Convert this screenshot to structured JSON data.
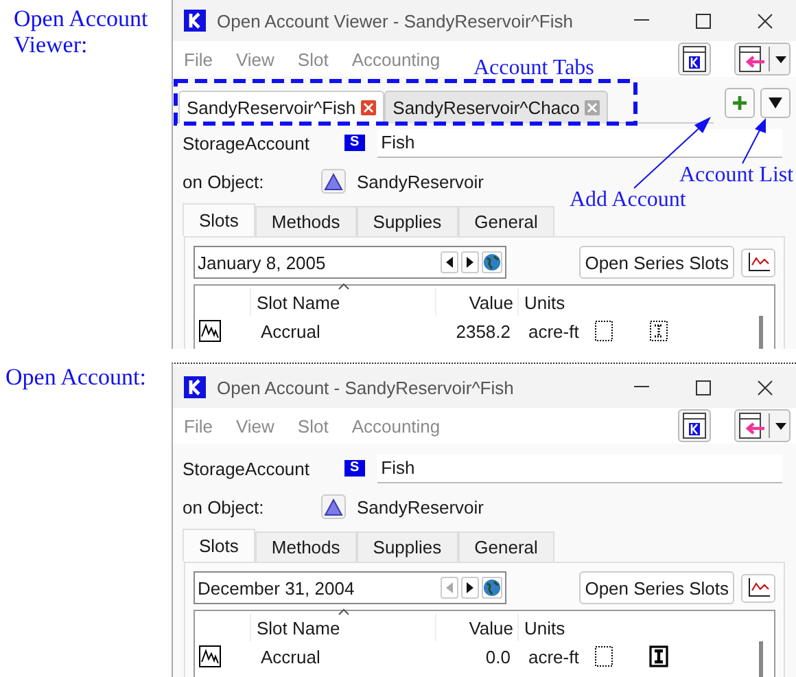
{
  "labels": [
    {
      "kind": "viewer",
      "text": "Open Account Viewer:"
    },
    {
      "kind": "account",
      "text": "Open Account:"
    }
  ],
  "callouts": [
    {
      "kind": "tabs",
      "text": "Account Tabs"
    },
    {
      "kind": "add",
      "text": "Add Account"
    },
    {
      "kind": "list",
      "text": "Account List"
    }
  ],
  "windows": [
    {
      "title": "Open Account Viewer - SandyReservoir^Fish",
      "menu": [
        "File",
        "View",
        "Slot",
        "Accounting"
      ],
      "account_tabs": [
        {
          "label": "SandyReservoir^Fish",
          "selected": true
        },
        {
          "label": "SandyReservoir^Chaco",
          "selected": false
        }
      ],
      "account_type": "StorageAccount",
      "type_badge": "S",
      "account_name": "Fish",
      "object_label": "on Object:",
      "object_name": "SandyReservoir",
      "tabs": [
        {
          "label": "Slots",
          "selected": true
        },
        {
          "label": "Methods",
          "selected": false
        },
        {
          "label": "Supplies",
          "selected": false
        },
        {
          "label": "General",
          "selected": false
        }
      ],
      "date": "January 8, 2005",
      "prev_disabled": false,
      "series_button": "Open Series Slots",
      "columns": [
        "Slot Name",
        "Value",
        "Units"
      ],
      "rows": [
        {
          "name": "Accrual",
          "value": "2358.2",
          "units": "acre-ft",
          "status_icons": [
            {
              "kind": "dotted-box"
            },
            {
              "kind": "dotted-i"
            }
          ]
        }
      ]
    },
    {
      "title": "Open Account - SandyReservoir^Fish",
      "menu": [
        "File",
        "View",
        "Slot",
        "Accounting"
      ],
      "account_type": "StorageAccount",
      "type_badge": "S",
      "account_name": "Fish",
      "object_label": "on Object:",
      "object_name": "SandyReservoir",
      "tabs": [
        {
          "label": "Slots",
          "selected": true
        },
        {
          "label": "Methods",
          "selected": false
        },
        {
          "label": "Supplies",
          "selected": false
        },
        {
          "label": "General",
          "selected": false
        }
      ],
      "date": "December 31, 2004",
      "prev_disabled": true,
      "series_button": "Open Series Slots",
      "columns": [
        "Slot Name",
        "Value",
        "Units"
      ],
      "rows": [
        {
          "name": "Accrual",
          "value": "0.0",
          "units": "acre-ft",
          "status_icons": [
            {
              "kind": "dotted-box"
            },
            {
              "kind": "solid-i"
            }
          ]
        }
      ]
    }
  ]
}
